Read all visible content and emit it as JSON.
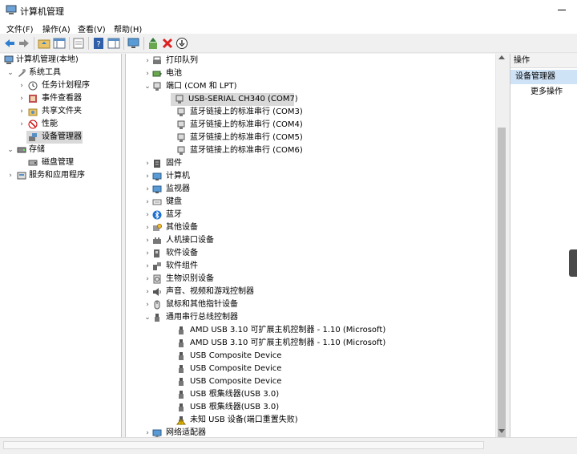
{
  "window": {
    "title": "计算机管理"
  },
  "menu": [
    "文件(F)",
    "操作(A)",
    "查看(V)",
    "帮助(H)"
  ],
  "left_tree": [
    {
      "label": "计算机管理(本地)",
      "depth": 0,
      "toggle": "",
      "icon": "computer-management-icon"
    },
    {
      "label": "系统工具",
      "depth": 1,
      "toggle": "v",
      "icon": "tools-icon"
    },
    {
      "label": "任务计划程序",
      "depth": 2,
      "toggle": ">",
      "icon": "clock-icon"
    },
    {
      "label": "事件查看器",
      "depth": 2,
      "toggle": ">",
      "icon": "event-viewer-icon"
    },
    {
      "label": "共享文件夹",
      "depth": 2,
      "toggle": ">",
      "icon": "shared-folder-icon"
    },
    {
      "label": "性能",
      "depth": 2,
      "toggle": ">",
      "icon": "performance-icon"
    },
    {
      "label": "设备管理器",
      "depth": 2,
      "toggle": "",
      "icon": "device-manager-icon",
      "selected": true
    },
    {
      "label": "存储",
      "depth": 1,
      "toggle": "v",
      "icon": "storage-icon"
    },
    {
      "label": "磁盘管理",
      "depth": 2,
      "toggle": "",
      "icon": "disk-icon"
    },
    {
      "label": "服务和应用程序",
      "depth": 1,
      "toggle": ">",
      "icon": "services-icon"
    }
  ],
  "device_tree": [
    {
      "label": "打印队列",
      "depth": 0,
      "toggle": ">",
      "icon": "printer-icon"
    },
    {
      "label": "电池",
      "depth": 0,
      "toggle": ">",
      "icon": "battery-icon"
    },
    {
      "label": "端口 (COM 和 LPT)",
      "depth": 0,
      "toggle": "v",
      "icon": "port-icon"
    },
    {
      "label": "USB-SERIAL CH340 (COM7)",
      "depth": 1,
      "toggle": "",
      "icon": "port-icon",
      "selected": true
    },
    {
      "label": "蓝牙链接上的标准串行 (COM3)",
      "depth": 1,
      "toggle": "",
      "icon": "port-icon"
    },
    {
      "label": "蓝牙链接上的标准串行 (COM4)",
      "depth": 1,
      "toggle": "",
      "icon": "port-icon"
    },
    {
      "label": "蓝牙链接上的标准串行 (COM5)",
      "depth": 1,
      "toggle": "",
      "icon": "port-icon"
    },
    {
      "label": "蓝牙链接上的标准串行 (COM6)",
      "depth": 1,
      "toggle": "",
      "icon": "port-icon"
    },
    {
      "label": "固件",
      "depth": 0,
      "toggle": ">",
      "icon": "firmware-icon"
    },
    {
      "label": "计算机",
      "depth": 0,
      "toggle": ">",
      "icon": "monitor-icon"
    },
    {
      "label": "监视器",
      "depth": 0,
      "toggle": ">",
      "icon": "monitor-icon"
    },
    {
      "label": "键盘",
      "depth": 0,
      "toggle": ">",
      "icon": "keyboard-icon"
    },
    {
      "label": "蓝牙",
      "depth": 0,
      "toggle": ">",
      "icon": "bluetooth-icon"
    },
    {
      "label": "其他设备",
      "depth": 0,
      "toggle": ">",
      "icon": "other-device-icon"
    },
    {
      "label": "人机接口设备",
      "depth": 0,
      "toggle": ">",
      "icon": "hid-icon"
    },
    {
      "label": "软件设备",
      "depth": 0,
      "toggle": ">",
      "icon": "software-device-icon"
    },
    {
      "label": "软件组件",
      "depth": 0,
      "toggle": ">",
      "icon": "software-component-icon"
    },
    {
      "label": "生物识别设备",
      "depth": 0,
      "toggle": ">",
      "icon": "biometric-icon"
    },
    {
      "label": "声音、视频和游戏控制器",
      "depth": 0,
      "toggle": ">",
      "icon": "speaker-icon"
    },
    {
      "label": "鼠标和其他指针设备",
      "depth": 0,
      "toggle": ">",
      "icon": "mouse-icon"
    },
    {
      "label": "通用串行总线控制器",
      "depth": 0,
      "toggle": "v",
      "icon": "usb-icon"
    },
    {
      "label": "AMD USB 3.10 可扩展主机控制器 - 1.10 (Microsoft)",
      "depth": 1,
      "toggle": "",
      "icon": "usb-icon"
    },
    {
      "label": "AMD USB 3.10 可扩展主机控制器 - 1.10 (Microsoft)",
      "depth": 1,
      "toggle": "",
      "icon": "usb-icon"
    },
    {
      "label": "USB Composite Device",
      "depth": 1,
      "toggle": "",
      "icon": "usb-icon"
    },
    {
      "label": "USB Composite Device",
      "depth": 1,
      "toggle": "",
      "icon": "usb-icon"
    },
    {
      "label": "USB Composite Device",
      "depth": 1,
      "toggle": "",
      "icon": "usb-icon"
    },
    {
      "label": "USB 根集线器(USB 3.0)",
      "depth": 1,
      "toggle": "",
      "icon": "usb-icon"
    },
    {
      "label": "USB 根集线器(USB 3.0)",
      "depth": 1,
      "toggle": "",
      "icon": "usb-icon"
    },
    {
      "label": "未知 USB 设备(端口重置失败)",
      "depth": 1,
      "toggle": "",
      "icon": "usb-warning-icon"
    },
    {
      "label": "网络适配器",
      "depth": 0,
      "toggle": ">",
      "icon": "network-icon"
    }
  ],
  "actions": {
    "header": "操作",
    "selected": "设备管理器",
    "more": "更多操作"
  },
  "colors": {
    "selection": "#cfe3f7",
    "tree_selection": "#d9d9d9",
    "toolbar_bg": "#f0f0f0"
  }
}
